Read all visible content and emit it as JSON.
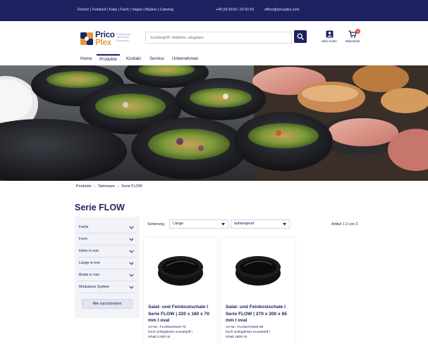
{
  "topbar": {
    "categories": "Fleisch | Feinkost | Käse | Fisch | Vegan | Bäcker | Catering",
    "phone": "+49 (0) 8193 / 23 60 60",
    "email": "office@pricoplex.com"
  },
  "logo": {
    "name_line1": "Prico",
    "name_line2": "Plex",
    "tagline": "Professionelle Lebensmittel Präsentation"
  },
  "search": {
    "placeholder": "Suchbegriff / Artikelnr. eingeben",
    "icon": "search-icon"
  },
  "account": {
    "label": "Mein Konto",
    "icon": "user-icon"
  },
  "cart": {
    "label": "Warenkorb",
    "count": "0",
    "icon": "cart-icon"
  },
  "nav": {
    "items": [
      {
        "label": "Home"
      },
      {
        "label": "Produkte"
      },
      {
        "label": "Kontakt"
      },
      {
        "label": "Service"
      },
      {
        "label": "Unternehmen"
      }
    ],
    "active": "Produkte"
  },
  "breadcrumb": {
    "items": [
      "Produkte",
      "Tableware",
      "Serie FLOW"
    ],
    "separator": "»"
  },
  "page": {
    "title": "Serie FLOW"
  },
  "filters": {
    "items": [
      {
        "label": "Farbe"
      },
      {
        "label": "Form"
      },
      {
        "label": "Höhe in mm"
      },
      {
        "label": "Länge in mm"
      },
      {
        "label": "Breite in mm"
      },
      {
        "label": "Modulares System"
      }
    ],
    "reset_label": "Alle zurücksetzen"
  },
  "sorting": {
    "label": "Sortierung",
    "field": "Länge",
    "order": "aufsteigend",
    "count_text": "Artikel 1-2 von 2"
  },
  "products": [
    {
      "title": "Salat- und Feinkostschale I Serie FLOW | 220 x 160 x 70 mm I oval",
      "article_no": "Art-Nr.: FLOW220160-70",
      "material": "hoch schlagfester Kunststoff I",
      "volume": "Inhalt 2.000 ml"
    },
    {
      "title": "Salat- und Feinkostschale I Serie FLOW | 270 x 200 x 85 mm I oval",
      "article_no": "Art-Nr.: FLOW270200-85",
      "material": "hoch schlagfester Kunststoff I",
      "volume": "Inhalt 1800 ml"
    }
  ],
  "colors": {
    "brand_navy": "#1d2260",
    "brand_orange": "#e09a3c",
    "cart_badge": "#e84a3c",
    "filter_panel": "#f2f3f8"
  }
}
